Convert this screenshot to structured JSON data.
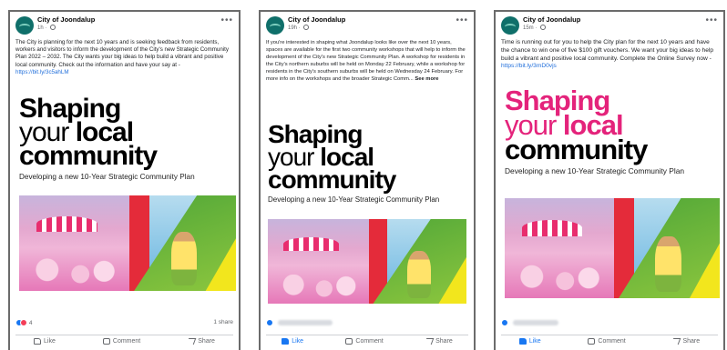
{
  "brand": {
    "page_name": "City of Joondalup",
    "link_color": "#216fdb",
    "like_color": "#1877f2"
  },
  "creative": {
    "headline_1": "Shaping",
    "headline_2a": "your ",
    "headline_2b": "local",
    "headline_3": "community",
    "subtitle": "Developing a new 10-Year Strategic Community Plan",
    "colors": {
      "pink": "#e678b8",
      "red": "#e42b3a",
      "green": "#3e9d36",
      "blue": "#66b4e0",
      "yellow": "#f2e61d"
    }
  },
  "posts": [
    {
      "time": "1h",
      "text": "The City is planning for the next 10 years and is seeking feedback from residents, workers and visitors to inform the development of the City's new Strategic Community Plan 2022 – 2032. The City wants your big ideas to help build a vibrant and positive local community. Check out the information and have your say at - ",
      "link": "https://bit.ly/3c5ahLM",
      "see_more": "",
      "reaction_count": "4",
      "shares": "1 share",
      "actions": {
        "like": "Like",
        "comment": "Comment",
        "share": "Share"
      }
    },
    {
      "time": "19h",
      "text": "If you're interested in shaping what Joondalup looks like over the next 10 years, spaces are available for the first two community workshops that will help to inform the development of the City's new Strategic Community Plan. A workshop for residents in the City's northern suburbs will be held on Monday 22 February, while a workshop for residents in the City's southern suburbs will be held on Wednesday 24 February. For more info on the workshops and the broader Strategic Comm... ",
      "link": "",
      "see_more": "See more",
      "reaction_count": "",
      "shares": "",
      "actions": {
        "like": "Like",
        "comment": "Comment",
        "share": "Share"
      }
    },
    {
      "time": "15m",
      "text": "Time is running out for you to help the City plan for the next 10 years and have the chance to win one of five $100 gift vouchers. We want your big ideas to help build a vibrant and positive local community. Complete the Online Survey now - ",
      "link": "https://bit.ly/3mD0vjs",
      "see_more": "",
      "reaction_count": "",
      "shares": "",
      "actions": {
        "like": "Like",
        "comment": "Comment",
        "share": "Share"
      }
    }
  ]
}
